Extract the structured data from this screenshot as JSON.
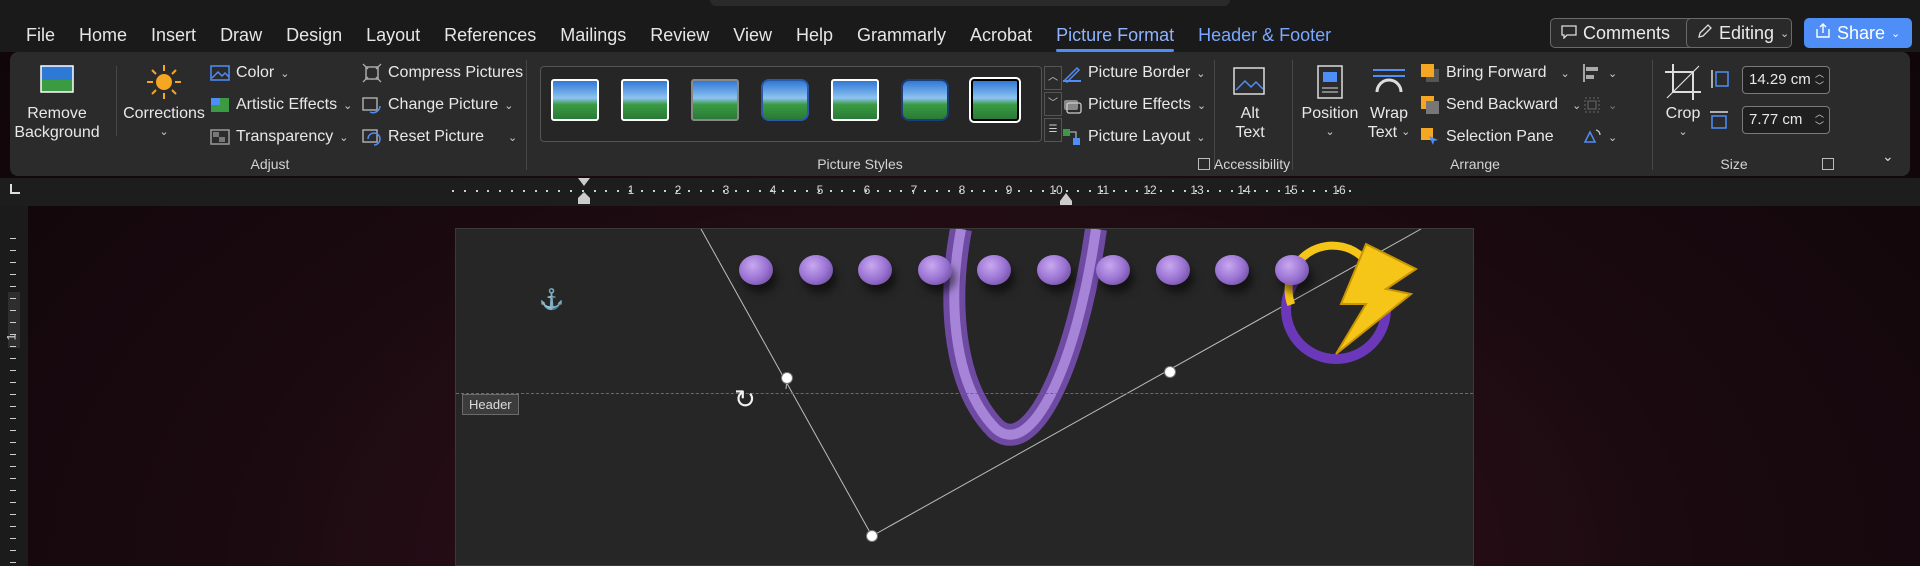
{
  "menu": {
    "tabs": [
      "File",
      "Home",
      "Insert",
      "Draw",
      "Design",
      "Layout",
      "References",
      "Mailings",
      "Review",
      "View",
      "Help",
      "Grammarly",
      "Acrobat",
      "Picture Format",
      "Header & Footer"
    ],
    "active_tab": "Picture Format",
    "comments_label": "Comments",
    "editing_label": "Editing",
    "share_label": "Share"
  },
  "ribbon": {
    "adjust": {
      "remove_background": "Remove Background",
      "remove_background_line1": "Remove",
      "remove_background_line2": "Background",
      "corrections": "Corrections",
      "color": "Color",
      "artistic_effects": "Artistic Effects",
      "transparency": "Transparency",
      "compress_pictures": "Compress Pictures",
      "change_picture": "Change Picture",
      "reset_picture": "Reset Picture",
      "group_label": "Adjust"
    },
    "picture_styles": {
      "group_label": "Picture Styles",
      "picture_border": "Picture Border",
      "picture_effects": "Picture Effects",
      "picture_layout": "Picture Layout"
    },
    "accessibility": {
      "alt_text_line1": "Alt",
      "alt_text_line2": "Text",
      "group_label": "Accessibility"
    },
    "arrange": {
      "position": "Position",
      "wrap_text_line1": "Wrap",
      "wrap_text_line2": "Text",
      "bring_forward": "Bring Forward",
      "send_backward": "Send Backward",
      "selection_pane": "Selection Pane",
      "group_label": "Arrange"
    },
    "size": {
      "crop": "Crop",
      "height": "14.29 cm",
      "width": "7.77 cm",
      "group_label": "Size"
    }
  },
  "ruler": {
    "numbers": [
      "1",
      "2",
      "3",
      "4",
      "5",
      "6",
      "7",
      "8",
      "9",
      "10",
      "11",
      "12",
      "13",
      "14",
      "15",
      "16"
    ],
    "vertical_number": "1"
  },
  "document": {
    "header_tag": "Header"
  },
  "colors": {
    "accent": "#4f8ef7",
    "active_tab": "#8fb4ff",
    "bead": "#9b74d4",
    "bolt": "#f5c518"
  }
}
